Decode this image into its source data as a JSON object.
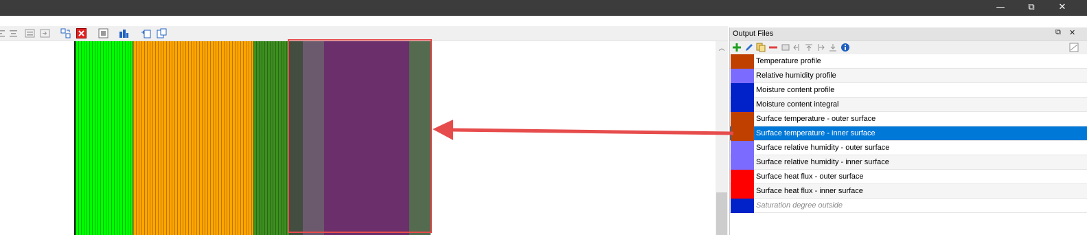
{
  "window": {
    "minimize_glyph": "—",
    "restore_glyph": "⧉",
    "close_glyph": "✕"
  },
  "toolbar": {
    "icons": [
      "align-left-icon",
      "align-center-icon",
      "align-right-icon",
      "indent-icon",
      "swap-layers-icon",
      "delete-layer-icon",
      "edit-layer-icon",
      "layer-properties-icon",
      "insert-layer-before-icon",
      "insert-layer-after-icon"
    ]
  },
  "construction": {
    "layers": [
      {
        "name": "layer-green",
        "color": "#00ff00"
      },
      {
        "name": "layer-orange",
        "color": "#ffa500"
      },
      {
        "name": "layer-darkgreen",
        "color": "#3c8f1f"
      },
      {
        "name": "layer-darkgray",
        "color": "#434d40"
      },
      {
        "name": "layer-mauve",
        "color": "#6b5a6d"
      },
      {
        "name": "layer-purple",
        "color": "#6b2f6b"
      },
      {
        "name": "layer-graygreen",
        "color": "#556b50"
      }
    ],
    "highlight_color": "#e74c4c"
  },
  "output_panel": {
    "title": "Output Files",
    "float_glyph": "⧉",
    "close_glyph": "✕",
    "toolbar_icons": [
      "add-icon",
      "edit-icon",
      "copy-icon",
      "remove-icon",
      "image-icon",
      "move-left-icon",
      "move-up-icon",
      "move-right-icon",
      "move-down-icon",
      "info-icon"
    ],
    "items": [
      {
        "label": "Temperature profile",
        "color": "#c04000"
      },
      {
        "label": "Relative humidity profile",
        "color": "#7b6cff"
      },
      {
        "label": "Moisture content profile",
        "color": "#0022c8"
      },
      {
        "label": "Moisture content integral",
        "color": "#0022c8"
      },
      {
        "label": "Surface temperature - outer surface",
        "color": "#c04000"
      },
      {
        "label": "Surface temperature - inner surface",
        "color": "#c04000",
        "selected": true
      },
      {
        "label": "Surface relative humidity - outer surface",
        "color": "#7b6cff"
      },
      {
        "label": "Surface relative humidity - inner surface",
        "color": "#7b6cff"
      },
      {
        "label": "Surface heat flux - outer surface",
        "color": "#ff0000"
      },
      {
        "label": "Surface heat flux - inner surface",
        "color": "#ff0000"
      },
      {
        "label": "Saturation degree outside",
        "color": "#0022c8",
        "inactive": true
      }
    ]
  },
  "annotation": {
    "arrow_color": "#e74c4c"
  }
}
